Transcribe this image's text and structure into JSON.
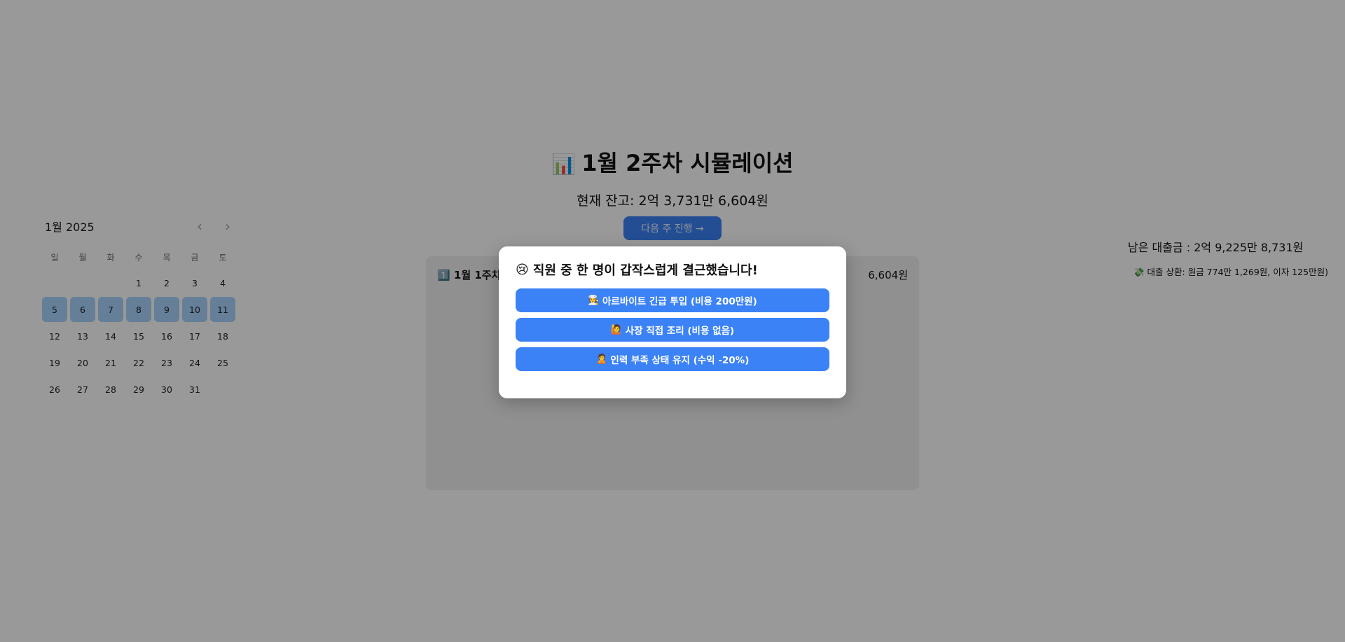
{
  "calendar": {
    "title": "1월 2025",
    "prev_icon": "chevron-left-icon",
    "next_icon": "chevron-right-icon",
    "prev_glyph": "‹",
    "next_glyph": "›",
    "weekdays": [
      "일",
      "월",
      "화",
      "수",
      "목",
      "금",
      "토"
    ],
    "weeks": [
      [
        "",
        "",
        "",
        "1",
        "2",
        "3",
        "4"
      ],
      [
        "5",
        "6",
        "7",
        "8",
        "9",
        "10",
        "11"
      ],
      [
        "12",
        "13",
        "14",
        "15",
        "16",
        "17",
        "18"
      ],
      [
        "19",
        "20",
        "21",
        "22",
        "23",
        "24",
        "25"
      ],
      [
        "26",
        "27",
        "28",
        "29",
        "30",
        "31",
        ""
      ]
    ],
    "selected_week_index": 1,
    "selected_color": "#a8d4ff"
  },
  "simulation": {
    "title_icon": "📊",
    "title": "1월 2주차 시뮬레이션",
    "balance": "현재 잔고: 2억 3,731만 6,604원",
    "next_button": "다음 주 진행 →",
    "week_row": {
      "label": "1️⃣ 1월 1주차 |",
      "amount": "6,604원"
    }
  },
  "loan": {
    "remaining": "남은 대출금 : 2억 9,225만 8,731원",
    "status": "💸 대출 상환: 원금 774만 1,269원, 이자 125만원)"
  },
  "modal": {
    "title_icon": "😢",
    "title": "직원 중 한 명이 갑작스럽게 결근했습니다!",
    "choices": [
      {
        "icon": "🧑‍🍳",
        "label": "아르바이트 긴급 투입 (비용 200만원)"
      },
      {
        "icon": "🙋",
        "label": "사장 직접 조리 (비용 없음)"
      },
      {
        "icon": "🙎",
        "label": "인력 부족 상태 유지 (수익 -20%)"
      }
    ]
  },
  "colors": {
    "accent": "#3b82f6",
    "overlay": "rgba(0,0,0,0.40)"
  }
}
